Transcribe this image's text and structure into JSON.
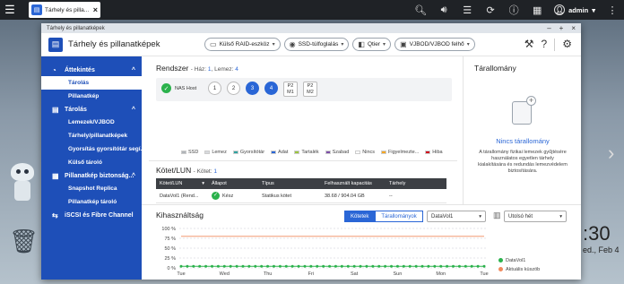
{
  "taskbar": {
    "tab_label": "Tárhely és pilla...",
    "user": "admin",
    "icons": [
      "menu-icon",
      "search-icon",
      "volume-icon",
      "tasks-icon",
      "sync-icon",
      "info-icon",
      "dashboard-icon",
      "user-icon",
      "more-icon"
    ]
  },
  "window": {
    "title": "Tárhely és pillanatképek",
    "app_title": "Tárhely és pillanatképek",
    "actions": [
      {
        "label": "Külső RAID-eszköz",
        "icon": "raid-icon"
      },
      {
        "label": "SSD-túlfoglalás",
        "icon": "ssd-icon"
      },
      {
        "label": "Qtier",
        "icon": "qtier-icon"
      },
      {
        "label": "VJBOD/VJBOD felhő",
        "icon": "vjbod-icon"
      }
    ]
  },
  "sidebar": {
    "sections": [
      {
        "label": "Áttekintés",
        "icon": "dashboard-icon",
        "items": [
          "Tárolás",
          "Pillanatkép"
        ]
      },
      {
        "label": "Tárolás",
        "icon": "storage-icon",
        "items": [
          "Lemezek/VJBOD",
          "Tárhely/pillanatképek",
          "Gyorsítás gyorsítótár segí...",
          "Külső tároló"
        ]
      },
      {
        "label": "Pillanatkép biztonság...",
        "icon": "snapshot-icon",
        "items": [
          "Snapshot Replica",
          "Pillanatkép tároló"
        ]
      },
      {
        "label": "iSCSI és Fibre Channel",
        "icon": "iscsi-icon",
        "items": []
      }
    ],
    "active_item": "Tárolás"
  },
  "system": {
    "title": "Rendszer",
    "sub_prefix": "- Ház:",
    "enclosures": "1",
    "disks_label": ", Lemez:",
    "disk_count": "4",
    "host_label": "NAS Host",
    "disks": [
      {
        "label": "1",
        "state": "empty"
      },
      {
        "label": "2",
        "state": "empty"
      },
      {
        "label": "3",
        "state": "used"
      },
      {
        "label": "4",
        "state": "used"
      }
    ],
    "m2_slots": [
      [
        "P2",
        "M1"
      ],
      [
        "P2",
        "M2"
      ]
    ],
    "legend": [
      {
        "label": "SSD",
        "color": "#b0b4b9"
      },
      {
        "label": "Lemez",
        "color": "#d8dadd"
      },
      {
        "label": "Gyorsítótár",
        "color": "#2fa3a0"
      },
      {
        "label": "Adat",
        "color": "#2a66d6"
      },
      {
        "label": "Tartalék",
        "color": "#9bc53d"
      },
      {
        "label": "Szabad",
        "color": "#7d4ea8"
      },
      {
        "label": "Nincs",
        "color": "#ffffff"
      },
      {
        "label": "Figyelmezte...",
        "color": "#f5a623"
      },
      {
        "label": "Hiba",
        "color": "#d0021b"
      }
    ]
  },
  "lun": {
    "title": "Kötet/LUN",
    "sub_prefix": "- Kötet:",
    "count": "1",
    "columns": [
      "Kötet/LUN",
      "Állapot",
      "Típus",
      "Felhasznált kapacitás",
      "Tárhely"
    ],
    "rows": [
      {
        "name": "DataVol1 (Rend...",
        "status": "Kész",
        "type": "Statikus kötet",
        "capacity": "38.68 / 904.04 GB",
        "pool": "--"
      }
    ]
  },
  "pool": {
    "title": "Tárallomány",
    "link": "Nincs tárallomány",
    "desc": "A tárallomány fizikai lemezek gyűjtésére használatos egyetlen tárhely kialakítására és redundás lemezvédelem biztosítására."
  },
  "utilization": {
    "title": "Kihasználtság",
    "tabs": [
      "Kötetek",
      "Tárallományok"
    ],
    "volume_select": "DataVol1",
    "range_select": "Utolsó hét",
    "legend": [
      {
        "label": "DataVol1",
        "color": "#2bb24c"
      },
      {
        "label": "Aktuális küszöb",
        "color": "#f08a5d"
      }
    ]
  },
  "chart_data": {
    "type": "line",
    "x": [
      "Tue",
      "Wed",
      "Thu",
      "Fri",
      "Sat",
      "Sun",
      "Mon",
      "Tue",
      "Wed",
      "Thu",
      "Fri",
      "Sat",
      "Sun",
      "Mon",
      "Tue",
      "Wed",
      "Thu",
      "Fri",
      "Sat",
      "Sun",
      "Mon",
      "Tue",
      "Wed",
      "Thu",
      "Fri",
      "Sat",
      "Sun",
      "Mon",
      "Tue",
      "Wed",
      "Thu",
      "Fri",
      "Sat",
      "Sun",
      "Mon",
      "Tue",
      "Wed",
      "Thu",
      "Fri",
      "Sat",
      "Sun",
      "Mon",
      "Tue",
      "Wed",
      "Thu",
      "Fri",
      "Sat",
      "Sun",
      "Mon",
      "Tue"
    ],
    "xticks": [
      "Tue",
      "Wed",
      "Thu",
      "Fri",
      "Sat",
      "Sun",
      "Mon",
      "Tue"
    ],
    "yticks": [
      "0 %",
      "25 %",
      "50 %",
      "75 %",
      "100 %"
    ],
    "ylim": [
      0,
      100
    ],
    "series": [
      {
        "name": "DataVol1",
        "values": [
          4,
          4,
          4,
          4,
          4,
          4,
          4,
          4,
          4,
          4,
          4,
          4,
          4,
          4,
          4,
          4,
          4,
          4,
          4,
          4,
          4,
          4,
          4,
          4,
          4,
          4,
          4,
          4,
          4,
          4,
          4,
          4,
          4,
          4,
          4,
          4,
          4,
          4,
          4,
          4,
          4,
          4,
          4,
          4,
          4,
          4,
          4,
          4,
          4,
          4
        ]
      },
      {
        "name": "Aktuális küszöb",
        "values": [
          80,
          80,
          80,
          80,
          80,
          80,
          80,
          80,
          80,
          80,
          80,
          80,
          80,
          80,
          80,
          80,
          80,
          80,
          80,
          80,
          80,
          80,
          80,
          80,
          80,
          80,
          80,
          80,
          80,
          80,
          80,
          80,
          80,
          80,
          80,
          80,
          80,
          80,
          80,
          80,
          80,
          80,
          80,
          80,
          80,
          80,
          80,
          80,
          80,
          80
        ]
      }
    ]
  },
  "desktop": {
    "clock": ":30",
    "date": "ed., Feb 4"
  }
}
